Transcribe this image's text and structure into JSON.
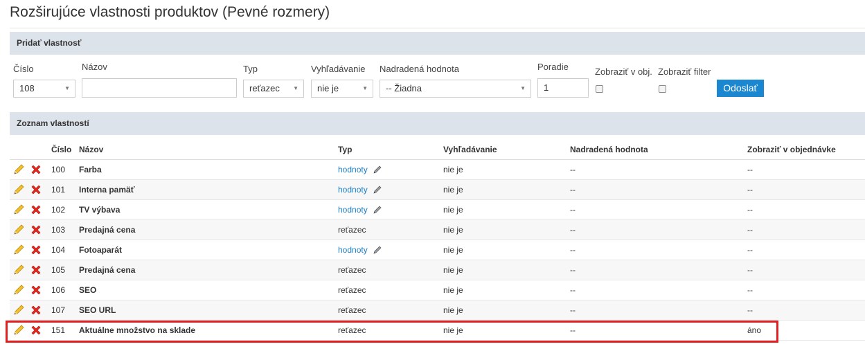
{
  "page_title": "Rozširujúce vlastnosti produktov (Pevné rozmery)",
  "add_section": {
    "header": "Pridať vlastnosť",
    "labels": {
      "cislo": "Číslo",
      "nazov": "Názov",
      "typ": "Typ",
      "vyhladavanie": "Vyhľadávanie",
      "nadradena": "Nadradená hodnota",
      "poradie": "Poradie",
      "zobrazit_obj": "Zobraziť v obj.",
      "zobrazit_filter": "Zobraziť filter"
    },
    "values": {
      "cislo": "108",
      "nazov": "",
      "typ": "reťazec",
      "vyhladavanie": "nie je",
      "nadradena": "-- Žiadna",
      "poradie": "1"
    },
    "submit_label": "Odoslať"
  },
  "list_section": {
    "header": "Zoznam vlastností",
    "columns": [
      "Číslo",
      "Názov",
      "Typ",
      "Vyhľadávanie",
      "Nadradená hodnota",
      "Zobraziť v objednávke"
    ],
    "rows": [
      {
        "cislo": "100",
        "nazov": "Farba",
        "typ": "hodnoty",
        "typ_link": true,
        "vyhladavanie": "nie je",
        "nadradena": "--",
        "zobrazit": "--"
      },
      {
        "cislo": "101",
        "nazov": "Interna pamäť",
        "typ": "hodnoty",
        "typ_link": true,
        "vyhladavanie": "nie je",
        "nadradena": "--",
        "zobrazit": "--"
      },
      {
        "cislo": "102",
        "nazov": "TV výbava",
        "typ": "hodnoty",
        "typ_link": true,
        "vyhladavanie": "nie je",
        "nadradena": "--",
        "zobrazit": "--"
      },
      {
        "cislo": "103",
        "nazov": "Predajná cena",
        "typ": "reťazec",
        "typ_link": false,
        "vyhladavanie": "nie je",
        "nadradena": "--",
        "zobrazit": "--"
      },
      {
        "cislo": "104",
        "nazov": "Fotoaparát",
        "typ": "hodnoty",
        "typ_link": true,
        "vyhladavanie": "nie je",
        "nadradena": "--",
        "zobrazit": "--"
      },
      {
        "cislo": "105",
        "nazov": "Predajná cena",
        "typ": "reťazec",
        "typ_link": false,
        "vyhladavanie": "nie je",
        "nadradena": "--",
        "zobrazit": "--"
      },
      {
        "cislo": "106",
        "nazov": "SEO",
        "typ": "reťazec",
        "typ_link": false,
        "vyhladavanie": "nie je",
        "nadradena": "--",
        "zobrazit": "--"
      },
      {
        "cislo": "107",
        "nazov": "SEO URL",
        "typ": "reťazec",
        "typ_link": false,
        "vyhladavanie": "nie je",
        "nadradena": "--",
        "zobrazit": "--"
      },
      {
        "cislo": "151",
        "nazov": "Aktuálne množstvo na sklade",
        "typ": "reťazec",
        "typ_link": false,
        "vyhladavanie": "nie je",
        "nadradena": "--",
        "zobrazit": "áno",
        "highlighted": true
      }
    ]
  },
  "colors": {
    "header_bg": "#dde3ea",
    "button_bg": "#1a87d0",
    "link": "#1a7dc4",
    "highlight": "#e02020"
  },
  "icons": {
    "edit": "pencil-icon",
    "delete": "red-x-icon",
    "select_caret": "caret-down-icon",
    "values_edit": "small-pencil-icon"
  }
}
